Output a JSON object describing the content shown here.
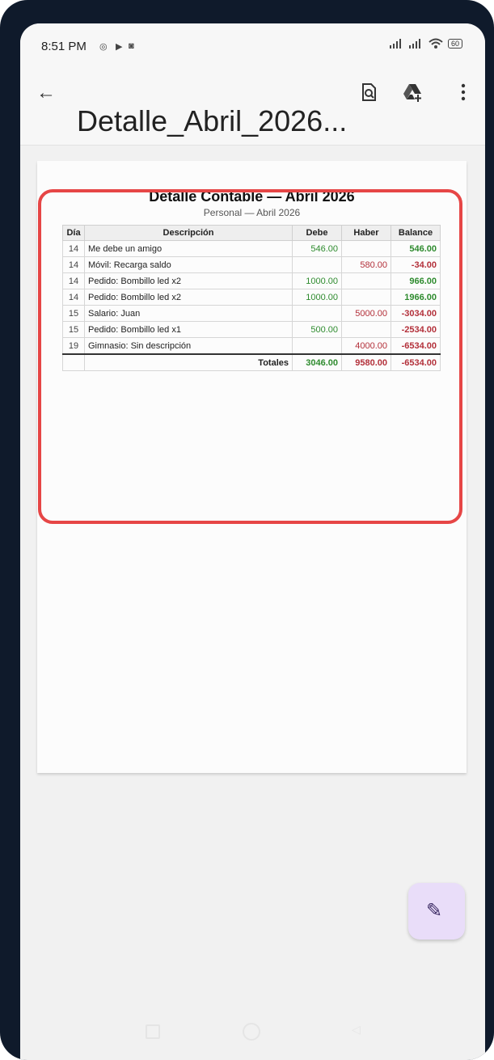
{
  "status": {
    "time": "8:51 PM",
    "battery": "60"
  },
  "appbar": {
    "back_icon": "arrow-left-icon",
    "title": "Detalle_Abril_2026...",
    "actions": [
      "document-search-icon",
      "google-drive-add-icon",
      "more-vert-icon"
    ]
  },
  "document": {
    "title": "Detalle Contable — Abril 2026",
    "subtitle": "Personal — Abril 2026",
    "headers": [
      "Día",
      "Descripción",
      "Debe",
      "Haber",
      "Balance"
    ],
    "rows": [
      {
        "day": "14",
        "desc": "Me debe un amigo",
        "debe": "546.00",
        "haber": "",
        "balance": "546.00"
      },
      {
        "day": "14",
        "desc": "Móvil: Recarga saldo",
        "debe": "",
        "haber": "580.00",
        "balance": "-34.00"
      },
      {
        "day": "14",
        "desc": "Pedido: Bombillo led x2",
        "debe": "1000.00",
        "haber": "",
        "balance": "966.00"
      },
      {
        "day": "14",
        "desc": "Pedido: Bombillo led x2",
        "debe": "1000.00",
        "haber": "",
        "balance": "1966.00"
      },
      {
        "day": "15",
        "desc": "Salario: Juan",
        "debe": "",
        "haber": "5000.00",
        "balance": "-3034.00"
      },
      {
        "day": "15",
        "desc": "Pedido: Bombillo led x1",
        "debe": "500.00",
        "haber": "",
        "balance": "-2534.00"
      },
      {
        "day": "19",
        "desc": "Gimnasio: Sin descripción",
        "debe": "",
        "haber": "4000.00",
        "balance": "-6534.00"
      }
    ],
    "totals": {
      "label": "Totales",
      "debe": "3046.00",
      "haber": "9580.00",
      "balance": "-6534.00"
    }
  },
  "fab": {
    "icon": "edit-pen-icon"
  },
  "colors": {
    "positive": "#2e8b2e",
    "negative": "#b3303a",
    "highlight": "#e64646"
  }
}
